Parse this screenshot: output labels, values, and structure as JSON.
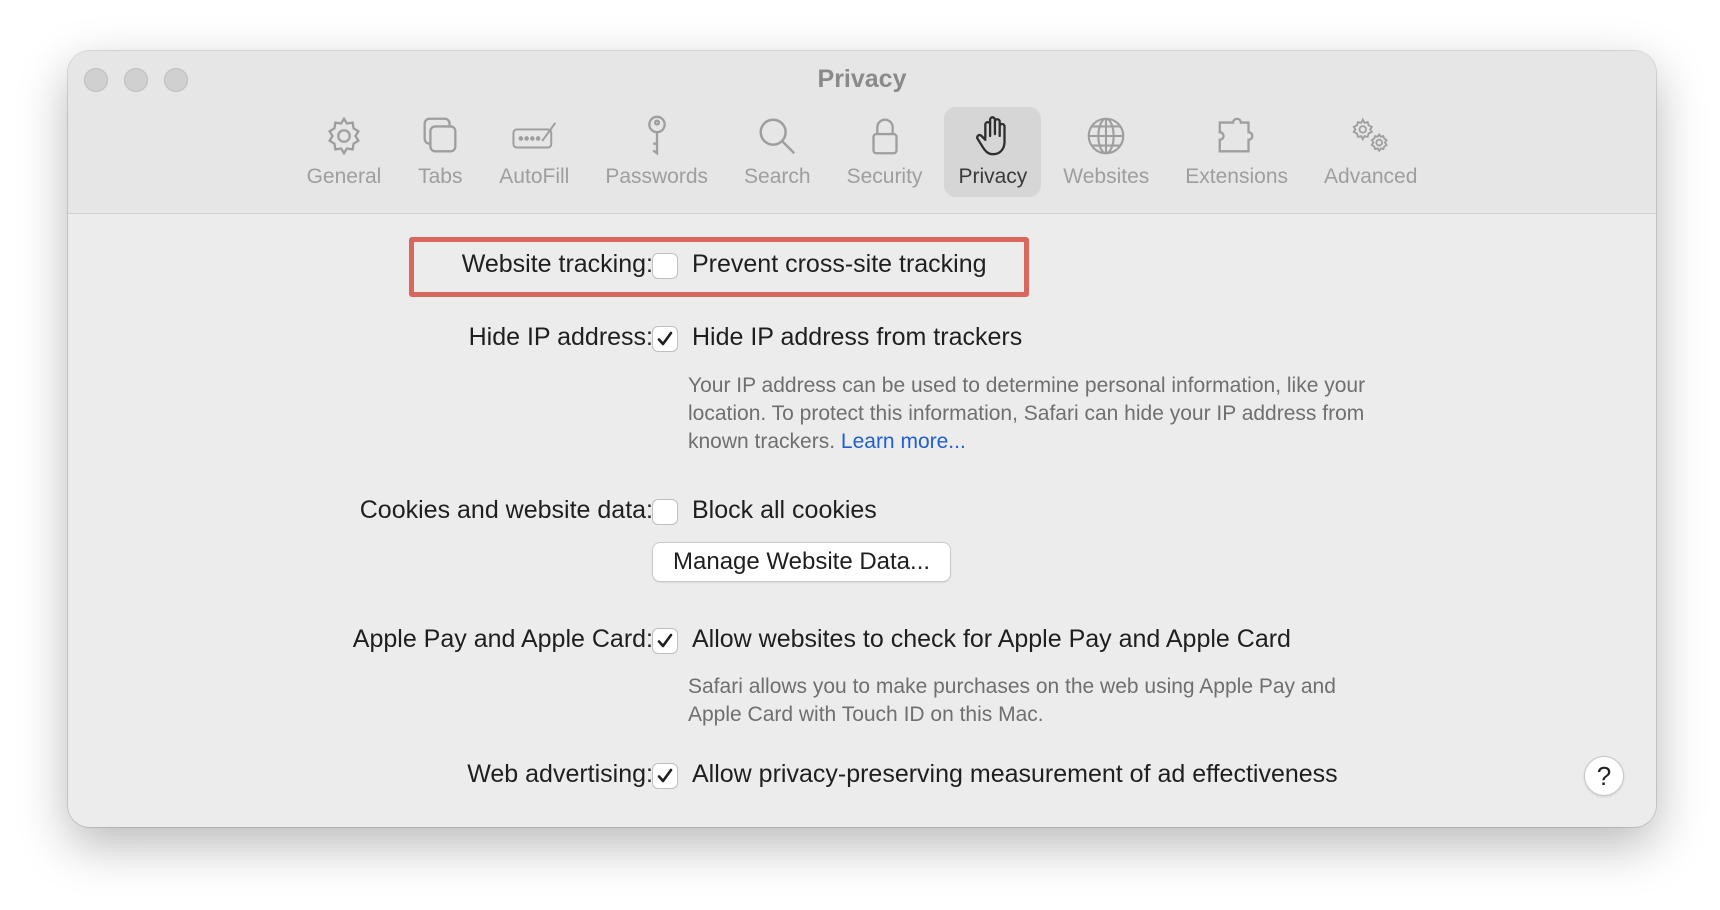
{
  "window": {
    "title": "Privacy"
  },
  "toolbar": {
    "items": [
      {
        "label": "General",
        "icon": "gear-icon",
        "active": false
      },
      {
        "label": "Tabs",
        "icon": "tabs-icon",
        "active": false
      },
      {
        "label": "AutoFill",
        "icon": "autofill-icon",
        "active": false
      },
      {
        "label": "Passwords",
        "icon": "key-icon",
        "active": false
      },
      {
        "label": "Search",
        "icon": "search-icon",
        "active": false
      },
      {
        "label": "Security",
        "icon": "lock-icon",
        "active": false
      },
      {
        "label": "Privacy",
        "icon": "hand-icon",
        "active": true
      },
      {
        "label": "Websites",
        "icon": "globe-icon",
        "active": false
      },
      {
        "label": "Extensions",
        "icon": "puzzle-icon",
        "active": false
      },
      {
        "label": "Advanced",
        "icon": "gears-icon",
        "active": false
      }
    ]
  },
  "settings": {
    "website_tracking": {
      "label": "Website tracking:",
      "option": "Prevent cross-site tracking",
      "checked": false
    },
    "hide_ip": {
      "label": "Hide IP address:",
      "option": "Hide IP address from trackers",
      "checked": true,
      "description": "Your IP address can be used to determine personal information, like your location. To protect this information, Safari can hide your IP address from known trackers.",
      "link": "Learn more..."
    },
    "cookies": {
      "label": "Cookies and website data:",
      "option": "Block all cookies",
      "checked": false,
      "button": "Manage Website Data..."
    },
    "apple_pay": {
      "label": "Apple Pay and Apple Card:",
      "option": "Allow websites to check for Apple Pay and Apple Card",
      "checked": true,
      "description": "Safari allows you to make purchases on the web using Apple Pay and Apple Card with Touch ID on this Mac."
    },
    "web_advertising": {
      "label": "Web advertising:",
      "option": "Allow privacy-preserving measurement of ad effectiveness",
      "checked": true
    }
  },
  "help": {
    "label": "?"
  },
  "colors": {
    "highlight": "#d9675c",
    "link": "#1f5fd1"
  }
}
